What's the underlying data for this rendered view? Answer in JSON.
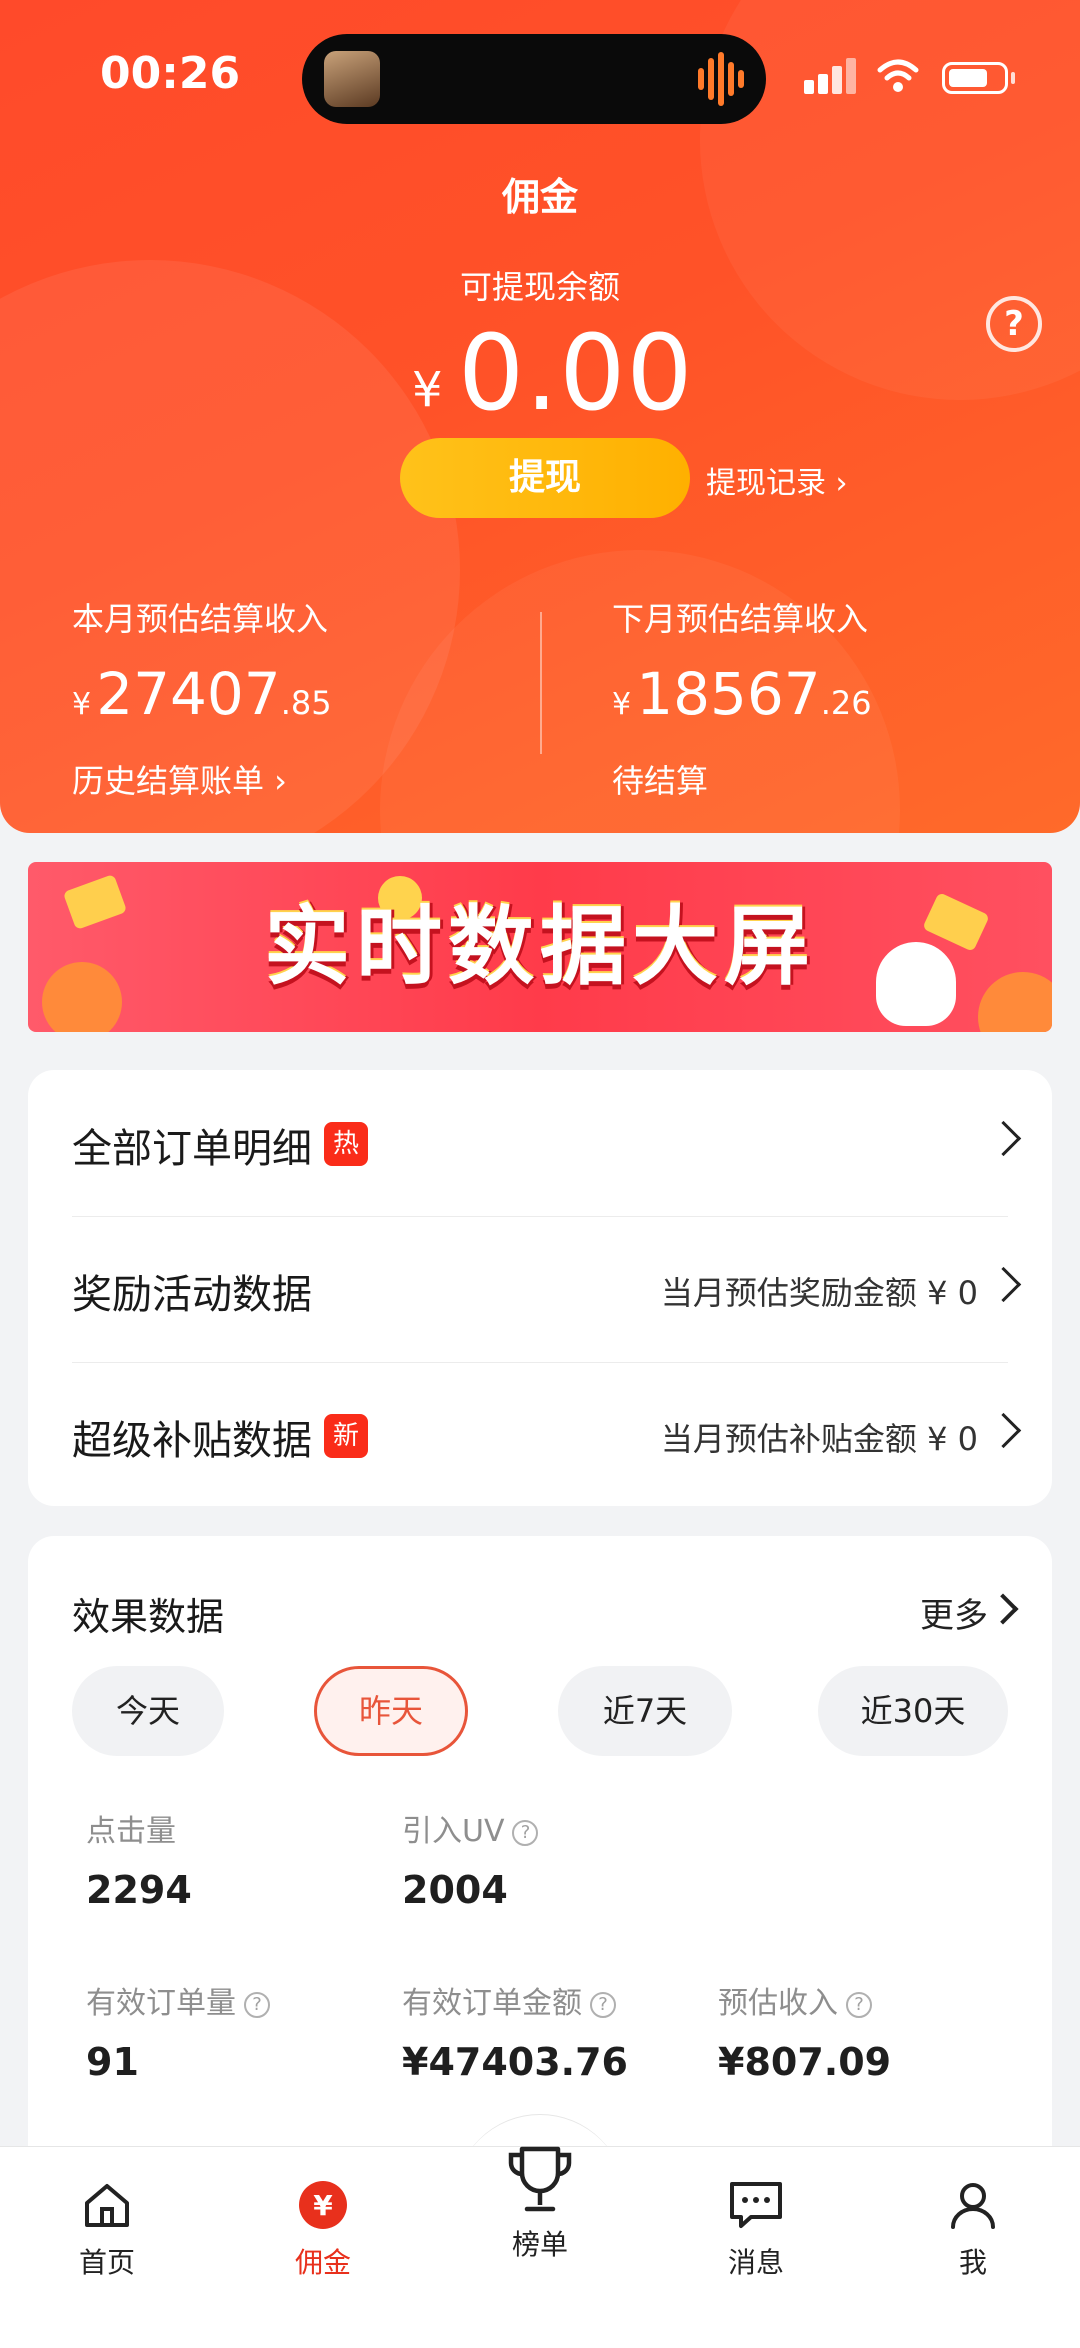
{
  "status_bar": {
    "time": "00:26"
  },
  "header": {
    "title": "佣金",
    "balance_label": "可提现余额",
    "balance_currency": "¥",
    "balance_amount": "0.00",
    "withdraw_button": "提现",
    "withdraw_record": "提现记录 ›",
    "this_month": {
      "label": "本月预估结算收入",
      "currency": "¥",
      "integer": "27407",
      "decimal": ".85",
      "link": "历史结算账单 ›"
    },
    "next_month": {
      "label": "下月预估结算收入",
      "currency": "¥",
      "integer": "18567",
      "decimal": ".26",
      "link": "待结算"
    }
  },
  "banner": {
    "text": "实时数据大屏"
  },
  "links": [
    {
      "title": "全部订单明细",
      "badge": "热",
      "right": ""
    },
    {
      "title": "奖励活动数据",
      "badge": "",
      "right": "当月预估奖励金额 ¥ 0"
    },
    {
      "title": "超级补贴数据",
      "badge": "新",
      "right": "当月预估补贴金额 ¥ 0"
    }
  ],
  "stats": {
    "title": "效果数据",
    "more": "更多",
    "ranges": [
      "今天",
      "昨天",
      "近7天",
      "近30天"
    ],
    "active_range": "昨天",
    "metrics": [
      {
        "label": "点击量",
        "value": "2294"
      },
      {
        "label": "引入UV",
        "value": "2004"
      },
      {
        "label": "有效订单量",
        "value": "91"
      },
      {
        "label": "有效订单金额",
        "value": "¥47403.76"
      },
      {
        "label": "预估收入",
        "value": "¥807.09"
      }
    ]
  },
  "tabbar": {
    "items": [
      {
        "label": "首页",
        "icon": "home-icon"
      },
      {
        "label": "佣金",
        "icon": "yuan-icon"
      },
      {
        "label": "榜单",
        "icon": "trophy-icon"
      },
      {
        "label": "消息",
        "icon": "message-icon"
      },
      {
        "label": "我",
        "icon": "user-icon"
      }
    ],
    "active": "佣金"
  },
  "colors": {
    "header_start": "#ff4a2a",
    "header_end": "#ff6a2a",
    "withdraw_button": "#ffb000",
    "accent_red": "#e8301c",
    "badge_red": "#fa2c19"
  }
}
